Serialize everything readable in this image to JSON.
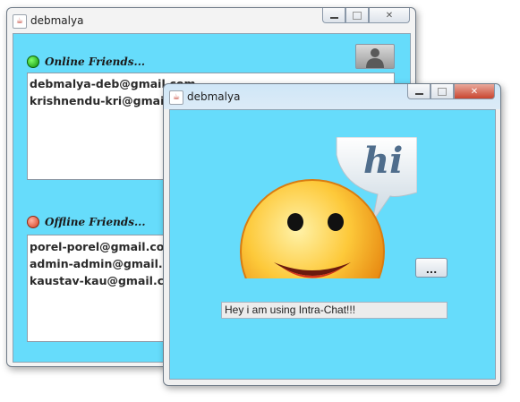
{
  "main_window": {
    "title": "debmalya",
    "online_header": "Online Friends...",
    "offline_header": "Offline Friends...",
    "online_friends": [
      "debmalya-deb@gmail.com",
      "krishnendu-kri@gmail.com"
    ],
    "offline_friends": [
      "porel-porel@gmail.com",
      "admin-admin@gmail.com",
      "kaustav-kau@gmail.com"
    ]
  },
  "chat_window": {
    "title": "debmalya",
    "status_message": "Hey i am using Intra-Chat!!!",
    "browse_button_label": "..."
  },
  "icons": {
    "app_icon": "java-cup-icon",
    "online_indicator": "green-dot-icon",
    "offline_indicator": "red-dot-icon",
    "avatar": "user-silhouette-icon",
    "profile_picture": "smiley-hi-icon"
  },
  "colors": {
    "panel_background": "#66dcfb",
    "online_dot": "#16a016",
    "offline_dot": "#d43b1b",
    "close_button_active": "#c9452f"
  }
}
